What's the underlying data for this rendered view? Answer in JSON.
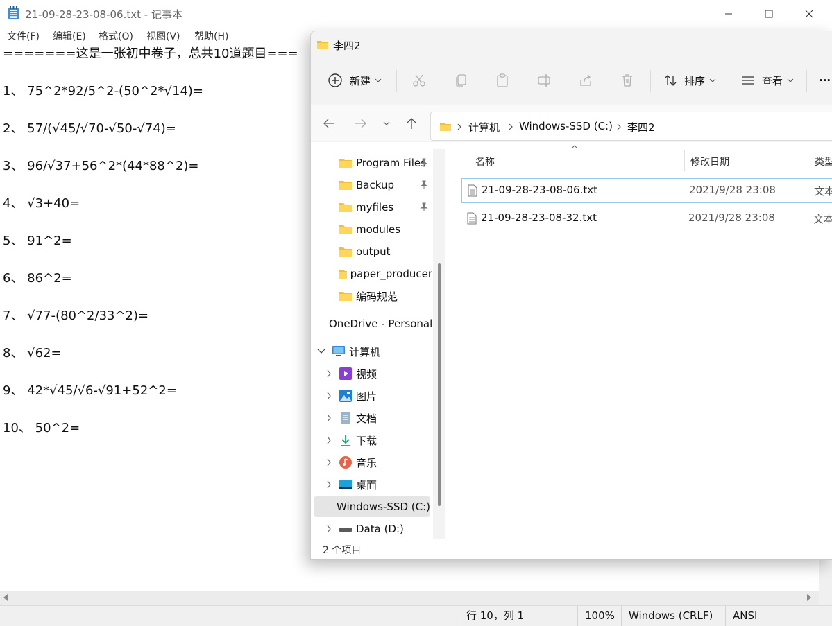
{
  "notepad": {
    "title": "21-09-28-23-08-06.txt - 记事本",
    "menu": [
      "文件(F)",
      "编辑(E)",
      "格式(O)",
      "视图(V)",
      "帮助(H)"
    ],
    "lines": [
      "=======这是一张初中卷子，总共10道题目===",
      "1、 75^2*92/5^2-(50^2*√14)=",
      "2、 57/(√45/√70-√50-√74)=",
      "3、 96/√37+56^2*(44*88^2)=",
      "4、 √3+40=",
      "5、 91^2=",
      "6、 86^2=",
      "7、 √77-(80^2/33^2)=",
      "8、 √62=",
      "9、 42*√45/√6-√91+52^2=",
      "10、 50^2="
    ],
    "status": {
      "position": "行 10，列 1",
      "zoom": "100%",
      "line_ending": "Windows (CRLF)",
      "encoding": "ANSI"
    }
  },
  "explorer": {
    "title": "李四2",
    "toolbar": {
      "new_label": "新建",
      "sort_label": "排序",
      "view_label": "查看",
      "more": "···"
    },
    "address": [
      "计算机",
      "Windows-SSD (C:)",
      "李四2"
    ],
    "nav": {
      "quick_access": [
        {
          "label": "Program Files",
          "pinned": true
        },
        {
          "label": "Backup",
          "pinned": true
        },
        {
          "label": "myfiles",
          "pinned": true
        },
        {
          "label": "modules",
          "pinned": false
        },
        {
          "label": "output",
          "pinned": false
        },
        {
          "label": "paper_producer",
          "pinned": false
        },
        {
          "label": "编码规范",
          "pinned": false
        }
      ],
      "onedrive": "OneDrive - Personal",
      "computer": "计算机",
      "computer_items": [
        "视频",
        "图片",
        "文档",
        "下载",
        "音乐",
        "桌面",
        "Windows-SSD (C:)",
        "Data (D:)"
      ]
    },
    "columns": {
      "name": "名称",
      "date": "修改日期",
      "type": "类型"
    },
    "files": [
      {
        "name": "21-09-28-23-08-06.txt",
        "date": "2021/9/28 23:08",
        "type": "文本文档"
      },
      {
        "name": "21-09-28-23-08-32.txt",
        "date": "2021/9/28 23:08",
        "type": "文本文档"
      }
    ],
    "status": "2 个项目"
  }
}
